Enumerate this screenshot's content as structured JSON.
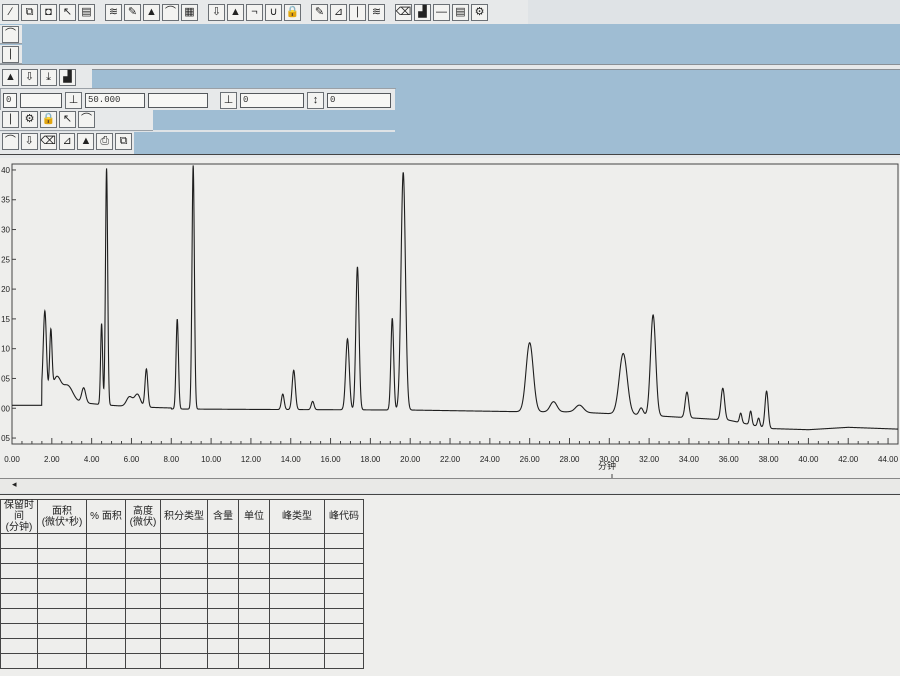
{
  "toolbar1": {
    "icons": [
      "select-icon",
      "integrate-icon",
      "zoom-icon",
      "peak-icon",
      "peak-start-icon",
      "peak-end-icon",
      "baseline-icon",
      "split-icon",
      "peak-mark-icon",
      "retention-icon",
      "skim-icon",
      "tangent-icon",
      "valley-icon",
      "report-icon",
      "calibrate-icon",
      "print-icon",
      "view-icon",
      "table-icon",
      "overlay-icon",
      "export-icon",
      "settings-icon",
      "copy-icon",
      "lock-icon",
      "disk-icon"
    ]
  },
  "toolbar2": {
    "icons": [
      "erase-icon"
    ]
  },
  "toolbar3": {
    "icons": [
      "edit-icon"
    ]
  },
  "toolbar4": {
    "icons": [
      "pin-icon",
      "chart-a-icon",
      "chart-b-icon",
      "chart-c-icon"
    ]
  },
  "params": {
    "field1": "0",
    "field2": "",
    "threshold_value": "50.000",
    "field4": "",
    "height_value": "0",
    "width_value": "0"
  },
  "toolbar6": {
    "icons": [
      "left-icon",
      "dropdown-icon",
      "doc-icon",
      "doc2-icon",
      "chart-d-icon"
    ]
  },
  "toolbar7": {
    "icons": [
      "slash-icon",
      "chart-e-icon",
      "pen-a-icon",
      "pen-b-icon",
      "pen-c-icon",
      "pen-d-icon",
      "book-icon"
    ]
  },
  "chart_data": {
    "type": "line",
    "xlabel": "分钟",
    "x_ticks": [
      "0.00",
      "2.00",
      "4.00",
      "6.00",
      "8.00",
      "10.00",
      "12.00",
      "14.00",
      "16.00",
      "18.00",
      "20.00",
      "22.00",
      "24.00",
      "26.00",
      "28.00",
      "30.00",
      "32.00",
      "34.00",
      "36.00",
      "38.00",
      "40.00",
      "42.00",
      "44.00"
    ],
    "y_ticks": [
      "40",
      "35",
      "30",
      "25",
      "20",
      "15",
      "10",
      "05",
      "00",
      "05"
    ],
    "xlim": [
      0,
      44.5
    ],
    "ylim": [
      -6,
      41
    ],
    "baseline": [
      [
        1.5,
        0
      ],
      [
        12.5,
        -0.2
      ],
      [
        20,
        -0.3
      ],
      [
        26,
        -0.6
      ],
      [
        28,
        -0.6
      ],
      [
        32,
        -1.2
      ],
      [
        36,
        -2.0
      ],
      [
        38,
        -3.4
      ],
      [
        40,
        -3.6
      ],
      [
        42,
        -3.2
      ],
      [
        44.5,
        -3.5
      ]
    ],
    "peaks": [
      {
        "rt": 1.65,
        "h": 14.2,
        "w": 0.08
      },
      {
        "rt": 1.95,
        "h": 10.3,
        "w": 0.06
      },
      {
        "rt": 2.25,
        "h": 3.5,
        "w": 0.2
      },
      {
        "rt": 2.8,
        "h": 2.5,
        "w": 0.25
      },
      {
        "rt": 3.6,
        "h": 2.5,
        "w": 0.1
      },
      {
        "rt": 4.5,
        "h": 13.6,
        "w": 0.05
      },
      {
        "rt": 4.75,
        "h": 39.7,
        "w": 0.055
      },
      {
        "rt": 5.9,
        "h": 1.6,
        "w": 0.15
      },
      {
        "rt": 6.3,
        "h": 2.1,
        "w": 0.15
      },
      {
        "rt": 6.75,
        "h": 6.4,
        "w": 0.07
      },
      {
        "rt": 8.3,
        "h": 15.1,
        "w": 0.06
      },
      {
        "rt": 9.1,
        "h": 40.9,
        "w": 0.06
      },
      {
        "rt": 13.6,
        "h": 2.6,
        "w": 0.07
      },
      {
        "rt": 14.15,
        "h": 6.6,
        "w": 0.08
      },
      {
        "rt": 15.1,
        "h": 1.4,
        "w": 0.07
      },
      {
        "rt": 16.85,
        "h": 11.9,
        "w": 0.09
      },
      {
        "rt": 17.35,
        "h": 24.0,
        "w": 0.08
      },
      {
        "rt": 19.1,
        "h": 15.4,
        "w": 0.07
      },
      {
        "rt": 19.65,
        "h": 39.9,
        "w": 0.11
      },
      {
        "rt": 26.0,
        "h": 11.6,
        "w": 0.18
      },
      {
        "rt": 27.2,
        "h": 1.7,
        "w": 0.17
      },
      {
        "rt": 28.5,
        "h": 1.2,
        "w": 0.2
      },
      {
        "rt": 30.7,
        "h": 10.2,
        "w": 0.2
      },
      {
        "rt": 31.6,
        "h": 1.2,
        "w": 0.1
      },
      {
        "rt": 32.2,
        "h": 16.9,
        "w": 0.13
      },
      {
        "rt": 33.9,
        "h": 4.3,
        "w": 0.09
      },
      {
        "rt": 35.7,
        "h": 5.3,
        "w": 0.09
      },
      {
        "rt": 36.6,
        "h": 1.6,
        "w": 0.06
      },
      {
        "rt": 37.1,
        "h": 2.3,
        "w": 0.06
      },
      {
        "rt": 37.5,
        "h": 1.4,
        "w": 0.06
      },
      {
        "rt": 37.9,
        "h": 6.2,
        "w": 0.08
      }
    ]
  },
  "table": {
    "headers": [
      {
        "l1": "保留时间",
        "l2": "(分钟)"
      },
      {
        "l1": "面积",
        "l2": "(微伏*秒)"
      },
      {
        "l1": "% 面积",
        "l2": ""
      },
      {
        "l1": "高度",
        "l2": "(微伏)"
      },
      {
        "l1": "积分类型",
        "l2": ""
      },
      {
        "l1": "含量",
        "l2": ""
      },
      {
        "l1": "单位",
        "l2": ""
      },
      {
        "l1": "峰类型",
        "l2": ""
      },
      {
        "l1": "峰代码",
        "l2": ""
      }
    ]
  }
}
